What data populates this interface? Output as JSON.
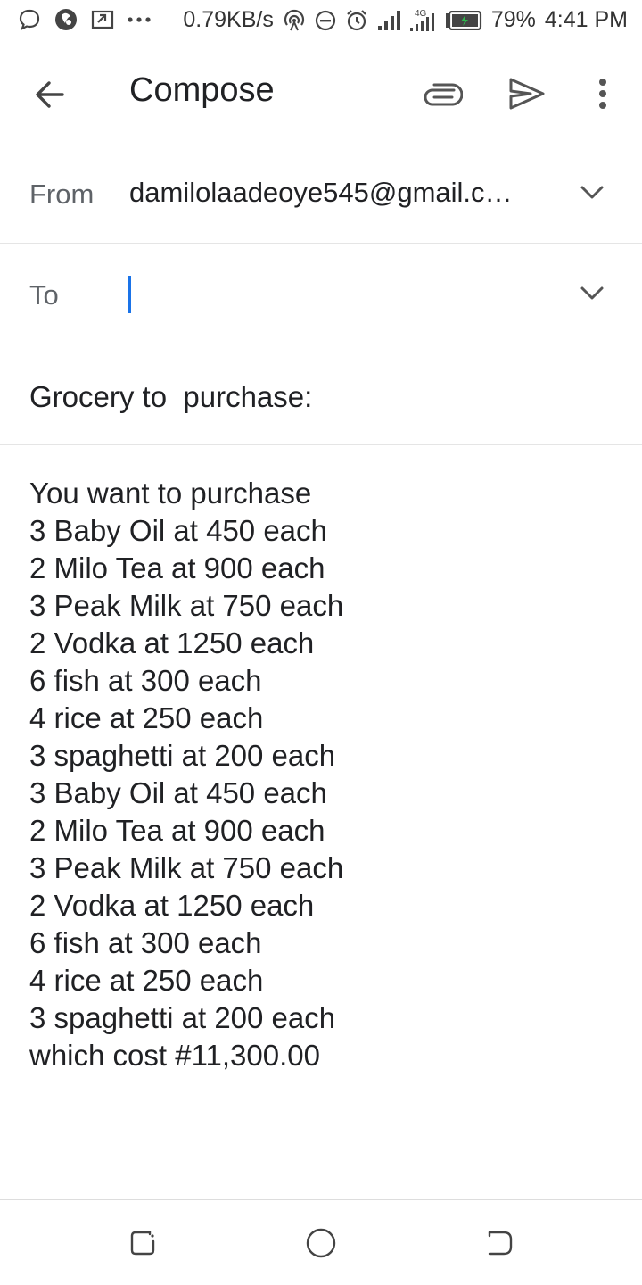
{
  "status_bar": {
    "network_speed": "0.79KB/s",
    "network_type": "4G",
    "battery_percent": "79%",
    "time": "4:41 PM",
    "left_icons": [
      "chat-bubble-icon",
      "app-notification-icon",
      "screenshot-icon",
      "more-notifications-icon"
    ],
    "right_icons": [
      "hotspot-icon",
      "do-not-disturb-icon",
      "alarm-icon",
      "signal-icon",
      "signal-4g-icon",
      "battery-icon"
    ]
  },
  "app_bar": {
    "title": "Compose",
    "icons": [
      "back-arrow-icon",
      "attachment-icon",
      "send-icon",
      "more-vert-icon"
    ]
  },
  "from_field": {
    "label": "From",
    "value": "damilolaadeoye545@gmail.c…"
  },
  "to_field": {
    "label": "To",
    "value": ""
  },
  "subject": {
    "value": "Grocery to  purchase:"
  },
  "body": {
    "lines": [
      "You want to purchase",
      "3 Baby Oil at 450 each",
      "2 Milo Tea at 900 each",
      "3 Peak Milk at 750 each",
      "2 Vodka at 1250 each",
      "6 fish at 300 each",
      "4 rice at 250 each",
      "3 spaghetti at 200 each",
      "3 Baby Oil at 450 each",
      "2 Milo Tea at 900 each",
      "3 Peak Milk at 750 each",
      "2 Vodka at 1250 each",
      "6 fish at 300 each",
      "4 rice at 250 each",
      "3 spaghetti at 200 each",
      "which cost #11,300.00"
    ]
  },
  "nav_bar": {
    "icons": [
      "recent-apps-icon",
      "home-icon",
      "back-nav-icon"
    ]
  },
  "colors": {
    "accent": "#1a73e8",
    "text": "#202124",
    "label": "#5f6368",
    "divider": "#e5e5e5",
    "battery_charge": "#2db84d"
  }
}
